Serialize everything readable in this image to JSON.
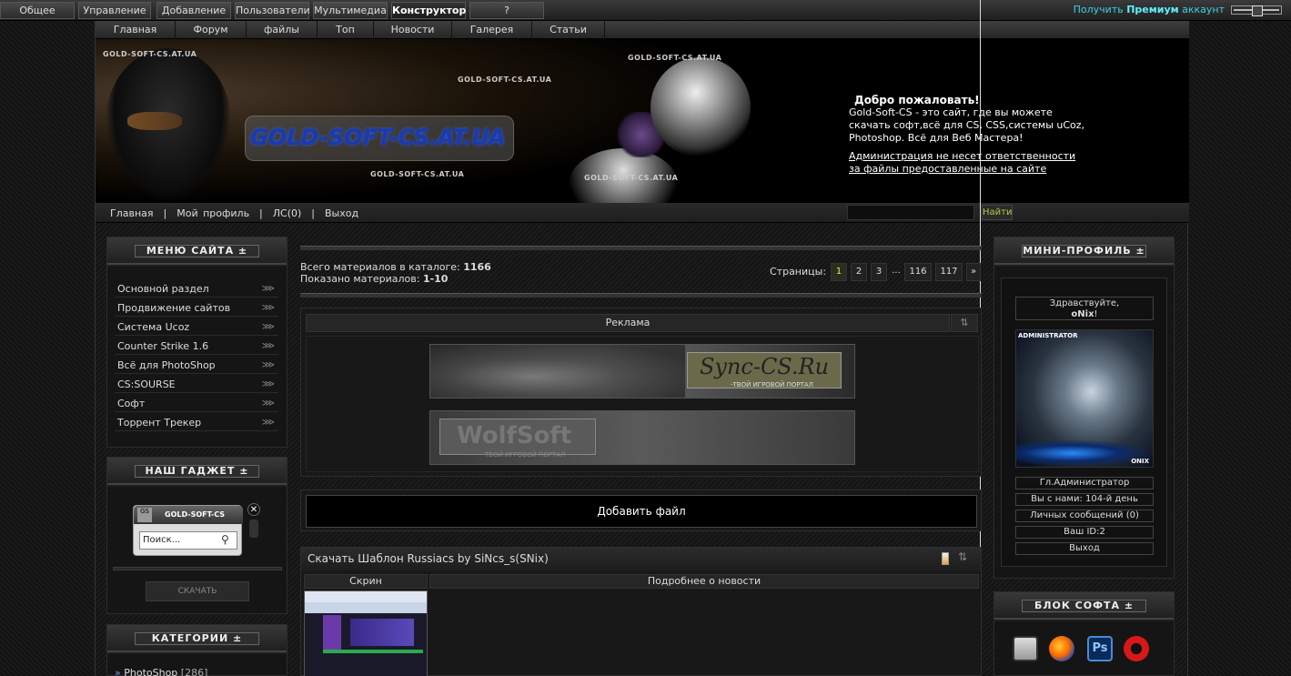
{
  "adminbar": {
    "tabs": [
      {
        "label": "Общее",
        "active": false
      },
      {
        "label": "Управление",
        "active": false
      },
      {
        "label": "Добавление",
        "active": false
      },
      {
        "label": "Пользователи",
        "active": false
      },
      {
        "label": "Мультимедиа",
        "active": false
      },
      {
        "label": "Конструктор",
        "active": true
      },
      {
        "label": "?",
        "active": false
      }
    ],
    "premium_pre": "Получить ",
    "premium_bold": "Премиум",
    "premium_post": " аккаунт"
  },
  "nav": {
    "items": [
      "Главная",
      "Форум",
      "файлы",
      "Топ",
      "Новости",
      "Галерея",
      "Статьи"
    ]
  },
  "header": {
    "logo_text": "GOLD-SOFT-CS.AT.UA",
    "watermark": "GOLD-SOFT-CS.AT.UA",
    "welcome_title": "Добро пожаловать!",
    "welcome_text": "Gold-Soft-CS - это сайт, где вы можете скачать софт,всё для CS, CSS,системы uCoz, Photoshop. Всё для Веб Мастера!",
    "disclaimer": "Администрация не несет ответственности за файлы предоставленные на сайте"
  },
  "userbar": {
    "links": [
      "Главная",
      "Мой профиль",
      "ЛС(0)",
      "Выход"
    ],
    "search_value": "",
    "find_label": "Найти"
  },
  "left": {
    "menu_title": "МЕНЮ САЙТА ±",
    "menu_items": [
      "Основной раздел",
      "Продвижение сайтов",
      "Система Ucoz",
      "Counter Strike 1.6",
      "Всё для PhotoShop",
      "CS:SOURSE",
      "Софт",
      "Торрент Трекер"
    ],
    "gadget_title": "НАШ ГАДЖЕТ ±",
    "gadget_name": "GOLD-SOFT-CS",
    "gadget_search": "Поиск...",
    "gadget_download": "СКАЧАТЬ",
    "categories_title": "КАТЕГОРИИ ±",
    "first_category": "PhotoShop",
    "first_category_count": "[286]"
  },
  "center": {
    "total_label": "Всего материалов в каталоге: ",
    "total_value": "1166",
    "shown_label": "Показано материалов: ",
    "shown_value": "1-10",
    "pages_label": "Страницы:",
    "pages": [
      "1",
      "2",
      "3",
      "...",
      "116",
      "117",
      "»"
    ],
    "current_page": "1",
    "ad_title": "Реклама",
    "ad1_text": "Sync-CS.Ru",
    "ad1_sub": "-ТВОЙ ИГРОВОЙ ПОРТАЛ",
    "ad2_text": "WolfSoft",
    "ad2_sub": "ТВОЙ ИГРОВОЙ ПОРТАЛ",
    "add_file": "Добавить файл",
    "post_title": "Скачать Шаблон Russiacs by SiNcs_s(SNix)",
    "col_screen": "Скрин",
    "col_details": "Подробнее о новости"
  },
  "right": {
    "profile_title": "МИНИ-ПРОФИЛЬ ±",
    "greeting": "Здравствуйте,",
    "username": "oNix",
    "avatar_label": "ADMINISTRATOR",
    "avatar_sign": "ONIX",
    "role": "Гл.Администратор",
    "days": "Вы с нами: 104-й день",
    "messages": "Личных сообщений (0)",
    "user_id": "Ваш ID:2",
    "logout": "Выход",
    "soft_title": "БЛОК СОФТА ±"
  }
}
